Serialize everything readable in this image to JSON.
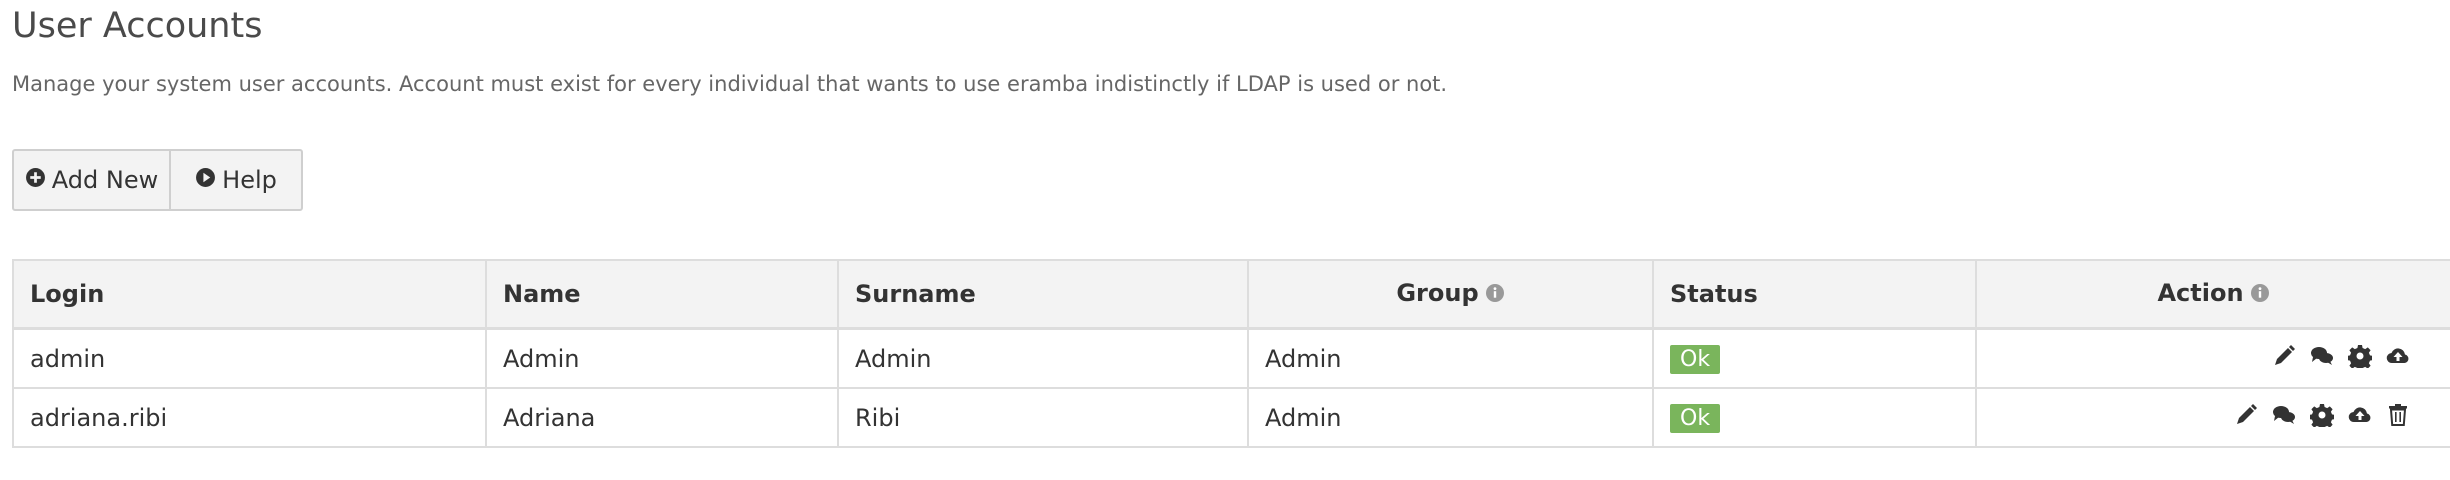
{
  "page": {
    "title": "User Accounts",
    "description": "Manage your system user accounts. Account must exist for every individual that wants to use eramba indistinctly if LDAP is used or not."
  },
  "toolbar": {
    "add_label": "Add New",
    "add_icon": "plus-circle-icon",
    "help_label": "Help",
    "help_icon": "play-circle-icon"
  },
  "table": {
    "headers": {
      "login": "Login",
      "name": "Name",
      "surname": "Surname",
      "group": "Group",
      "status": "Status",
      "action": "Action"
    },
    "rows": [
      {
        "login": "admin",
        "name": "Admin",
        "surname": "Admin",
        "group": "Admin",
        "status": "Ok",
        "actions": [
          "edit-icon",
          "comments-icon",
          "settings-icon",
          "upload-icon"
        ]
      },
      {
        "login": "adriana.ribi",
        "name": "Adriana",
        "surname": "Ribi",
        "group": "Admin",
        "status": "Ok",
        "actions": [
          "edit-icon",
          "comments-icon",
          "settings-icon",
          "upload-icon",
          "trash-icon"
        ]
      }
    ]
  },
  "colors": {
    "status_ok": "#7ab55c",
    "header_bg": "#f3f3f3",
    "border": "#dddddd"
  }
}
